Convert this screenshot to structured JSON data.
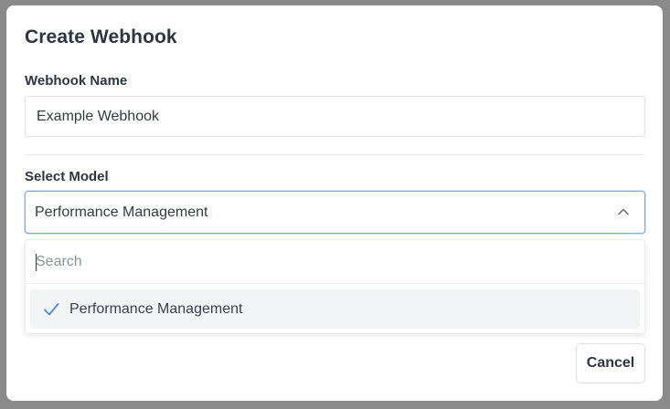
{
  "modal": {
    "title": "Create Webhook"
  },
  "webhook_name": {
    "label": "Webhook Name",
    "value": "Example Webhook"
  },
  "select_model": {
    "label": "Select Model",
    "selected": "Performance Management",
    "search_placeholder": "Search",
    "options": [
      {
        "label": "Performance Management",
        "selected": true
      }
    ]
  },
  "footer": {
    "cancel_label": "Cancel"
  },
  "colors": {
    "accent": "#4a89dc",
    "focus_border": "#7ea9e0",
    "text": "#2f3441"
  },
  "icons": {
    "select_toggle": "chevron-up-icon",
    "selected_option": "check-icon"
  }
}
